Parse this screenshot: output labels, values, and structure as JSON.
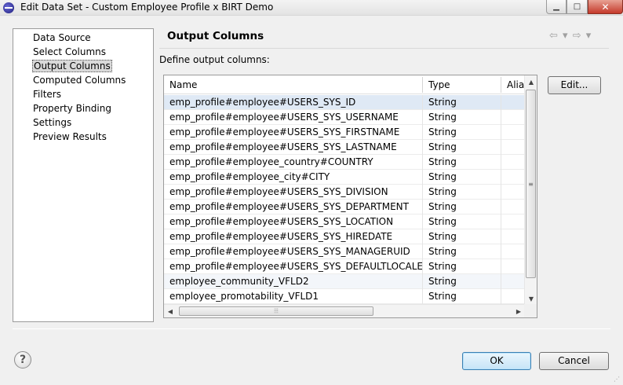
{
  "window": {
    "title": "Edit Data Set - Custom Employee Profile x BIRT Demo",
    "minimize_glyph": "▁",
    "maximize_glyph": "□",
    "close_glyph": "✕"
  },
  "nav": {
    "items": [
      {
        "label": "Data Source",
        "selected": false
      },
      {
        "label": "Select Columns",
        "selected": false
      },
      {
        "label": "Output Columns",
        "selected": true
      },
      {
        "label": "Computed Columns",
        "selected": false
      },
      {
        "label": "Filters",
        "selected": false
      },
      {
        "label": "Property Binding",
        "selected": false
      },
      {
        "label": "Settings",
        "selected": false
      },
      {
        "label": "Preview Results",
        "selected": false
      }
    ]
  },
  "page": {
    "title": "Output Columns",
    "back_glyph": "⇦",
    "forward_glyph": "⇨",
    "dropdown_glyph": "▾",
    "define_label": "Define output columns:"
  },
  "table": {
    "columns": [
      "Name",
      "Type",
      "Alias"
    ],
    "rows": [
      {
        "name": "emp_profile#employee#USERS_SYS_ID",
        "type": "String"
      },
      {
        "name": "emp_profile#employee#USERS_SYS_USERNAME",
        "type": "String"
      },
      {
        "name": "emp_profile#employee#USERS_SYS_FIRSTNAME",
        "type": "String"
      },
      {
        "name": "emp_profile#employee#USERS_SYS_LASTNAME",
        "type": "String"
      },
      {
        "name": "emp_profile#employee_country#COUNTRY",
        "type": "String"
      },
      {
        "name": "emp_profile#employee_city#CITY",
        "type": "String"
      },
      {
        "name": "emp_profile#employee#USERS_SYS_DIVISION",
        "type": "String"
      },
      {
        "name": "emp_profile#employee#USERS_SYS_DEPARTMENT",
        "type": "String"
      },
      {
        "name": "emp_profile#employee#USERS_SYS_LOCATION",
        "type": "String"
      },
      {
        "name": "emp_profile#employee#USERS_SYS_HIREDATE",
        "type": "String"
      },
      {
        "name": "emp_profile#employee#USERS_SYS_MANAGERUID",
        "type": "String"
      },
      {
        "name": "emp_profile#employee#USERS_SYS_DEFAULTLOCALE",
        "type": "String"
      },
      {
        "name": "employee_community_VFLD2",
        "type": "String"
      },
      {
        "name": "employee_promotability_VFLD1",
        "type": "String"
      }
    ]
  },
  "buttons": {
    "edit": "Edit...",
    "ok": "OK",
    "cancel": "Cancel"
  },
  "help": {
    "glyph": "?"
  }
}
